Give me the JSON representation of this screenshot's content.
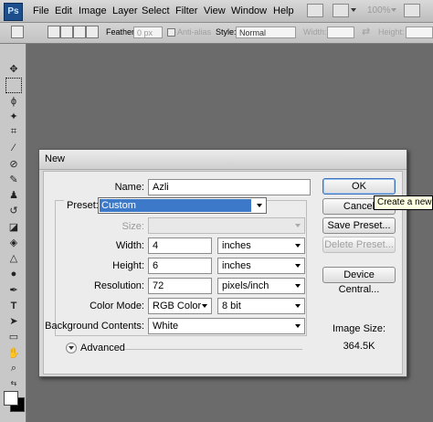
{
  "app": {
    "logo": "Ps"
  },
  "menubar": {
    "items": [
      "File",
      "Edit",
      "Image",
      "Layer",
      "Select",
      "Filter",
      "View",
      "Window",
      "Help"
    ],
    "zoom": "100%"
  },
  "options": {
    "feather_label": "Feather:",
    "feather_value": "0 px",
    "antialias_label": "Anti-alias",
    "style_label": "Style:",
    "style_value": "Normal",
    "width_label": "Width:",
    "height_label": "Height:"
  },
  "dialog": {
    "title": "New",
    "name_label": "Name:",
    "name_value": "Azli",
    "preset_label": "Preset:",
    "preset_value": "Custom",
    "size_label": "Size:",
    "width_label": "Width:",
    "width_value": "4",
    "width_unit": "inches",
    "height_label": "Height:",
    "height_value": "6",
    "height_unit": "inches",
    "resolution_label": "Resolution:",
    "resolution_value": "72",
    "resolution_unit": "pixels/inch",
    "colormode_label": "Color Mode:",
    "colormode_value": "RGB Color",
    "bitdepth_value": "8 bit",
    "bg_label": "Background Contents:",
    "bg_value": "White",
    "advanced_label": "Advanced",
    "buttons": {
      "ok": "OK",
      "cancel": "Cancel",
      "save_preset": "Save Preset...",
      "delete_preset": "Delete Preset...",
      "device_central": "Device Central..."
    },
    "image_size_label": "Image Size:",
    "image_size_value": "364.5K"
  },
  "tooltip": "Create a new do",
  "colors": {
    "selection": "#3c79c9",
    "tooltip_bg": "#ffffe1",
    "ps_logo_bg": "#1c4f8c"
  }
}
